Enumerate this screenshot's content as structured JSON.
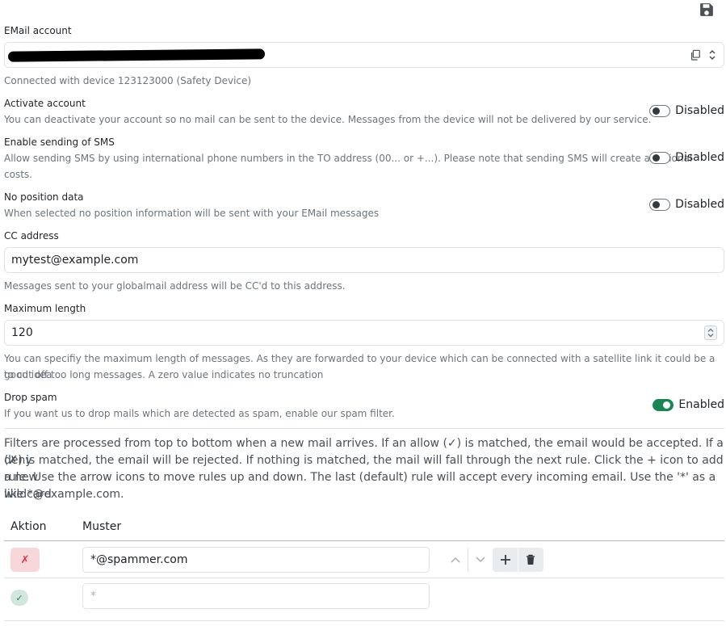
{
  "email": {
    "label": "EMail account",
    "connected_text": "Connected with device 123123000 (Safety Device)"
  },
  "activate": {
    "title": "Activate account",
    "help": "You can deactivate your account so no mail can be sent to the device. Messages from the device will not be delivered by our service.",
    "state": "Disabled"
  },
  "sms": {
    "title": "Enable sending of SMS",
    "help_line1": "Allow sending SMS by using international phone numbers in the TO address (00... or +...). Please note that sending SMS will create additional",
    "help_line2": "costs.",
    "state": "Disabled"
  },
  "position": {
    "title": "No position data",
    "help": "When selected no position information will be sent with your EMail messages",
    "state": "Disabled"
  },
  "cc": {
    "label": "CC address",
    "value": "mytest@example.com",
    "help": "Messages sent to your globalmail address will be CC'd to this address."
  },
  "maxlen": {
    "label": "Maximum length",
    "value": "120",
    "help_line1": "You can specifiy the maximum length of messages. As they are forwarded to your device which can be connected with a satellite link it could be a good idea",
    "help_line2": "to cut off too long messages. A zero value indicates no truncation"
  },
  "spam": {
    "title": "Drop spam",
    "help": "If you want us to drop mails which are detected as spam, enable our spam filter.",
    "state": "Enabled"
  },
  "filters": {
    "info_line1": "Filters are processed from top to bottom when a new mail arrives. If an allow (✓) is matched, the email would be accepted. If a deny",
    "info_line2": "(✗) is matched, the email will be rejected. If nothing is matched, the mail will fall through the next rule. Click the + icon to add a new",
    "info_line3": "rule. Use the arrow icons to move rules up and down. The last (default) rule will accept every incoming email. Use the '*' as a wildcard",
    "info_line4": "like *@example.com.",
    "col_action": "Aktion",
    "col_pattern": "Muster",
    "rules": [
      {
        "action_symbol": "✗",
        "pattern": "*@spammer.com"
      },
      {
        "action_symbol": "✓",
        "pattern_placeholder": "*"
      }
    ]
  },
  "colors": {
    "deny_bg": "#f8d7da",
    "deny_fg": "#dc3545",
    "allow_bg": "#d1e7dd",
    "allow_fg": "#198754",
    "switch_on": "#198754"
  },
  "icons": [
    "save-icon",
    "copy-icon",
    "chevron-updown-icon",
    "chevron-up-icon",
    "chevron-down-icon",
    "plus-icon",
    "trash-icon"
  ]
}
